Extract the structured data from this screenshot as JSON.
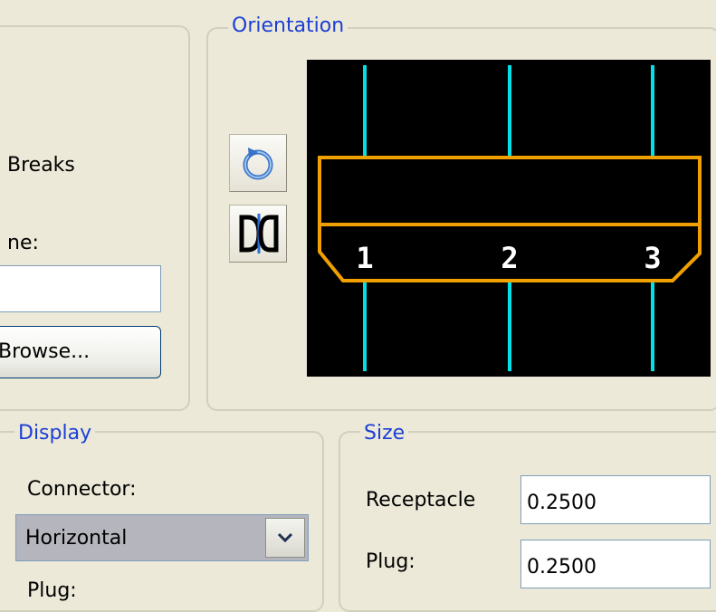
{
  "left_panel": {
    "breaks_label": "Breaks",
    "name_label": "ne:",
    "name_value": "",
    "browse_button": "Browse..."
  },
  "orientation": {
    "title": "Orientation",
    "rotate_icon": "rotate-icon",
    "flip_icon": "flip-icon",
    "preview": {
      "pins": [
        "1",
        "2",
        "3"
      ],
      "wire_color": "#00e0e8",
      "body_color": "#f0a000",
      "pin_label_color": "#ffffff"
    }
  },
  "display": {
    "title": "Display",
    "connector_label": "Connector:",
    "connector_value": "Horizontal",
    "plug_label": "Plug:"
  },
  "size": {
    "title": "Size",
    "receptacle_label": "Receptacle",
    "receptacle_value": "0.2500",
    "plug_label": "Plug:",
    "plug_value": "0.2500"
  },
  "colors": {
    "accent_title": "#1c3fd6",
    "window_bg": "#ece9d8",
    "combo_selected_bg": "#b5b5bd"
  }
}
